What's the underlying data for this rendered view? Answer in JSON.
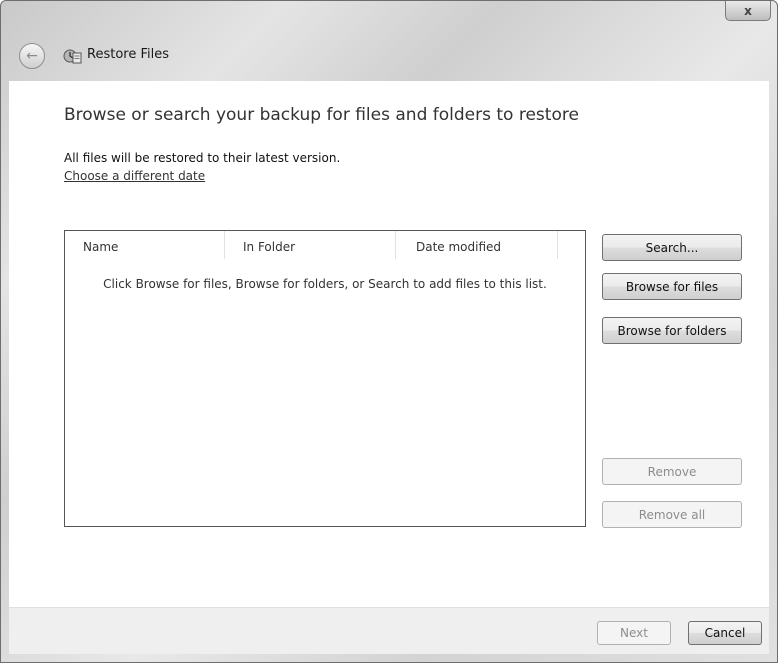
{
  "window": {
    "title": "Restore Files",
    "close_glyph": "x"
  },
  "header": {
    "back_icon": "back-arrow-icon",
    "app_icon": "restore-files-icon"
  },
  "main": {
    "heading": "Browse or search your backup for files and folders to restore",
    "subtext": "All files will be restored to their latest version.",
    "link": "Choose a different date"
  },
  "file_list": {
    "columns": [
      "Name",
      "In Folder",
      "Date modified"
    ],
    "empty_message": "Click Browse for files, Browse for folders, or Search to add files to this list."
  },
  "actions": {
    "search": "Search...",
    "browse_files": "Browse for files",
    "browse_folders": "Browse for folders",
    "remove": "Remove",
    "remove_all": "Remove all"
  },
  "footer": {
    "next": "Next",
    "cancel": "Cancel"
  }
}
